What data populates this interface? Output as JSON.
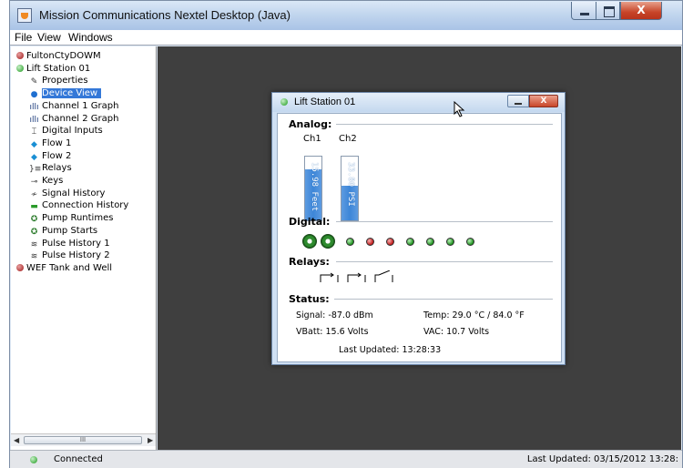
{
  "app": {
    "title": "Mission Communications Nextel Desktop (Java)",
    "close_label": "X"
  },
  "menu": [
    "File",
    "View",
    "Windows"
  ],
  "tree": [
    {
      "label": "FultonCtyDOWM",
      "icon": "status-red-icon"
    },
    {
      "label": "Lift Station 01",
      "icon": "status-green-icon"
    },
    {
      "label": "Properties",
      "icon": "properties-icon"
    },
    {
      "label": "Device View",
      "icon": "globe-icon",
      "selected": true
    },
    {
      "label": "Channel 1 Graph",
      "icon": "bar-graph-icon"
    },
    {
      "label": "Channel 2 Graph",
      "icon": "bar-graph-icon"
    },
    {
      "label": "Digital Inputs",
      "icon": "digital-icon"
    },
    {
      "label": "Flow 1",
      "icon": "flow-icon"
    },
    {
      "label": "Flow 2",
      "icon": "flow-icon"
    },
    {
      "label": "Relays",
      "icon": "relay-icon"
    },
    {
      "label": "Keys",
      "icon": "key-icon"
    },
    {
      "label": "Signal History",
      "icon": "signal-icon"
    },
    {
      "label": "Connection History",
      "icon": "connection-icon"
    },
    {
      "label": "Pump Runtimes",
      "icon": "pump-icon"
    },
    {
      "label": "Pump Starts",
      "icon": "pump-icon"
    },
    {
      "label": "Pulse History 1",
      "icon": "pulse-icon"
    },
    {
      "label": "Pulse History 2",
      "icon": "pulse-icon"
    },
    {
      "label": "WEF Tank and Well",
      "icon": "status-red-icon"
    }
  ],
  "scrollbar": {
    "thumb_label": "III"
  },
  "statusbar": {
    "connection": "Connected",
    "last_updated": "Last Updated: 03/15/2012 13:28:"
  },
  "device_window": {
    "title": "Lift Station 01",
    "close_label": "X",
    "analog": {
      "heading": "Analog:",
      "channels": [
        {
          "label": "Ch1",
          "reading": "15.98 Feet",
          "level": 0.8
        },
        {
          "label": "Ch2",
          "reading": "33.80 PSI",
          "level": 0.55
        }
      ]
    },
    "digital": {
      "heading": "Digital:",
      "pumps": [
        "pump-1-icon",
        "pump-2-icon"
      ],
      "inputs": [
        "green",
        "red",
        "red",
        "green",
        "green",
        "green",
        "green"
      ]
    },
    "relays": {
      "heading": "Relays:",
      "states": [
        "open",
        "open",
        "closed"
      ]
    },
    "status": {
      "heading": "Status:",
      "signal": "Signal: -87.0 dBm",
      "temp": "Temp: 29.0 °C / 84.0 °F",
      "vbatt": "VBatt: 15.6 Volts",
      "vac": "VAC: 10.7 Volts",
      "updated": "Last Updated: 13:28:33"
    }
  }
}
